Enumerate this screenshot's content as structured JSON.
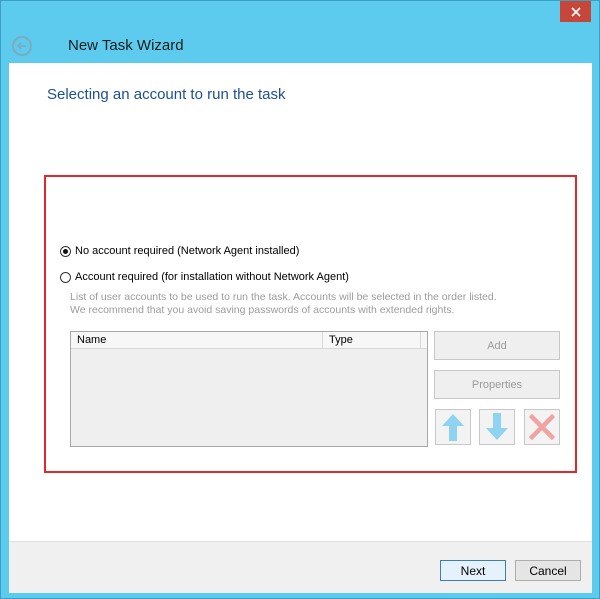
{
  "window": {
    "title": "New Task Wizard",
    "accent_color": "#5ccbed",
    "close_icon": "close-icon",
    "back_icon": "back-arrow-icon"
  },
  "page": {
    "heading": "Selecting an account to run the task"
  },
  "options": {
    "no_account": {
      "label": "No account required (Network Agent installed)",
      "selected": true
    },
    "account_required": {
      "label": "Account required (for installation without Network Agent)",
      "selected": false
    },
    "hint_line1": "List of user accounts to be used to run the task. Accounts will be selected in the order listed.",
    "hint_line2": "We recommend that you avoid saving passwords of accounts with extended rights."
  },
  "accounts_table": {
    "columns": [
      "Name",
      "Type"
    ],
    "rows": []
  },
  "side_buttons": {
    "add": "Add",
    "properties": "Properties",
    "move_up_icon": "arrow-up-icon",
    "move_down_icon": "arrow-down-icon",
    "delete_icon": "delete-x-icon"
  },
  "footer": {
    "next": "Next",
    "cancel": "Cancel"
  }
}
